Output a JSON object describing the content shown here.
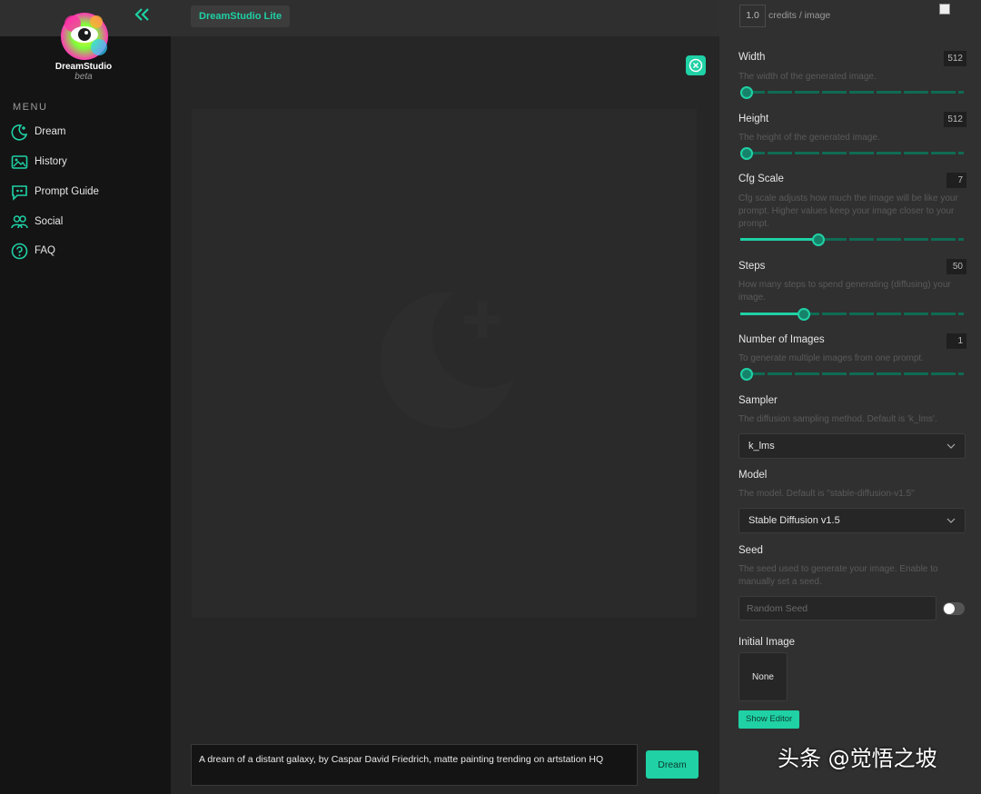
{
  "header": {
    "app_badge": "DreamStudio Lite",
    "collapse_icon": "double-chevron-left-icon"
  },
  "brand": {
    "name": "DreamStudio",
    "sub": "beta"
  },
  "sidebar": {
    "menu_title": "MENU",
    "items": [
      {
        "label": "Dream",
        "icon": "moon-star-icon"
      },
      {
        "label": "History",
        "icon": "image-icon"
      },
      {
        "label": "Prompt Guide",
        "icon": "quote-bubble-icon"
      },
      {
        "label": "Social",
        "icon": "users-icon"
      },
      {
        "label": "FAQ",
        "icon": "question-circle-icon"
      }
    ]
  },
  "main": {
    "prompt": "A dream of a distant galaxy, by Caspar David Friedrich, matte painting trending on artstation HQ",
    "dream_label": "Dream"
  },
  "settings": {
    "credits_value": "1.0",
    "credits_label": "credits / image",
    "width": {
      "label": "Width",
      "value": "512",
      "desc": "The width of the generated image.",
      "fraction": 0.0
    },
    "height": {
      "label": "Height",
      "value": "512",
      "desc": "The height of the generated image.",
      "fraction": 0.0
    },
    "cfg": {
      "label": "Cfg Scale",
      "value": "7",
      "desc": "Cfg scale adjusts how much the image will be like your prompt. Higher values keep your image closer to your prompt.",
      "fraction": 0.35
    },
    "steps": {
      "label": "Steps",
      "value": "50",
      "desc": "How many steps to spend generating (diffusing) your image.",
      "fraction": 0.285
    },
    "num_images": {
      "label": "Number of Images",
      "value": "1",
      "desc": "To generate multiple images from one prompt.",
      "fraction": 0.0
    },
    "sampler": {
      "label": "Sampler",
      "desc": "The diffusion sampling method. Default is 'k_lms'.",
      "value": "k_lms"
    },
    "model": {
      "label": "Model",
      "desc": "The model. Default is \"stable-diffusion-v1.5\"",
      "value": "Stable Diffusion v1.5"
    },
    "seed": {
      "label": "Seed",
      "desc": "The seed used to generate your image. Enable to manually set a seed.",
      "placeholder": "Random Seed"
    },
    "initial_image": {
      "label": "Initial Image",
      "value": "None",
      "show_editor": "Show Editor"
    }
  },
  "watermark": "头条 @觉悟之坡",
  "colors": {
    "accent": "#1fd1a5",
    "sidebar_bg": "#141414",
    "panel_bg": "#303030"
  }
}
